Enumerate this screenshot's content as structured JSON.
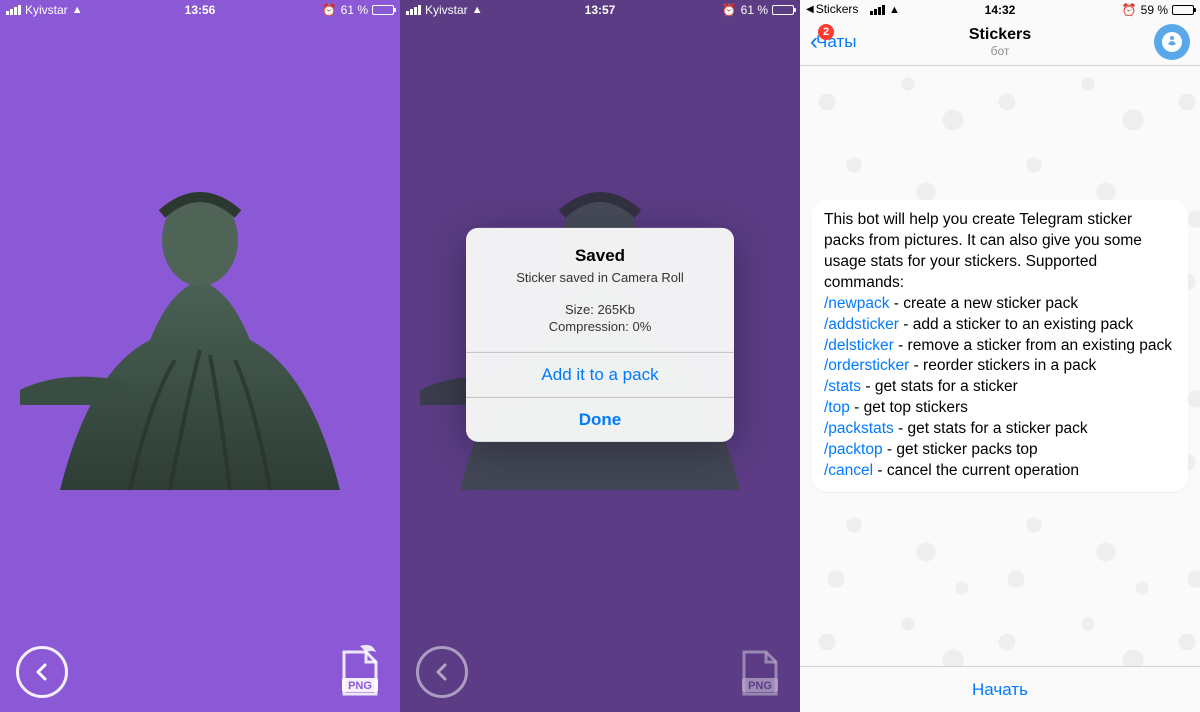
{
  "screen1": {
    "status": {
      "carrier": "Kyivstar",
      "time": "13:56",
      "battery_pct": "61 %"
    },
    "png_label": "PNG"
  },
  "screen2": {
    "status": {
      "carrier": "Kyivstar",
      "time": "13:57",
      "battery_pct": "61 %"
    },
    "png_label": "PNG",
    "alert": {
      "title": "Saved",
      "message": "Sticker saved in Camera Roll",
      "size_line": "Size: 265Kb",
      "compression_line": "Compression: 0%",
      "add_btn": "Add it to a pack",
      "done_btn": "Done"
    }
  },
  "screen3": {
    "breadcrumb": "Stickers",
    "status": {
      "time": "14:32",
      "battery_pct": "59 %"
    },
    "back_label": "Чаты",
    "badge": "2",
    "title": "Stickers",
    "subtitle": "бот",
    "message": {
      "intro": "This bot will help you create Telegram sticker packs from pictures. It can also give you some usage stats for your stickers. Supported commands:",
      "commands": [
        {
          "cmd": "/newpack",
          "desc": " - create a new sticker pack"
        },
        {
          "cmd": "/addsticker",
          "desc": " - add a sticker to an existing pack"
        },
        {
          "cmd": "/delsticker",
          "desc": " - remove a sticker from an existing pack"
        },
        {
          "cmd": "/ordersticker",
          "desc": " - reorder stickers in a pack"
        },
        {
          "cmd": "/stats",
          "desc": " - get stats for a sticker"
        },
        {
          "cmd": "/top",
          "desc": " - get top stickers"
        },
        {
          "cmd": "/packstats",
          "desc": " - get stats for a sticker pack"
        },
        {
          "cmd": "/packtop",
          "desc": " - get sticker packs top"
        },
        {
          "cmd": "/cancel",
          "desc": " - cancel the current operation"
        }
      ]
    },
    "start_btn": "Начать"
  }
}
